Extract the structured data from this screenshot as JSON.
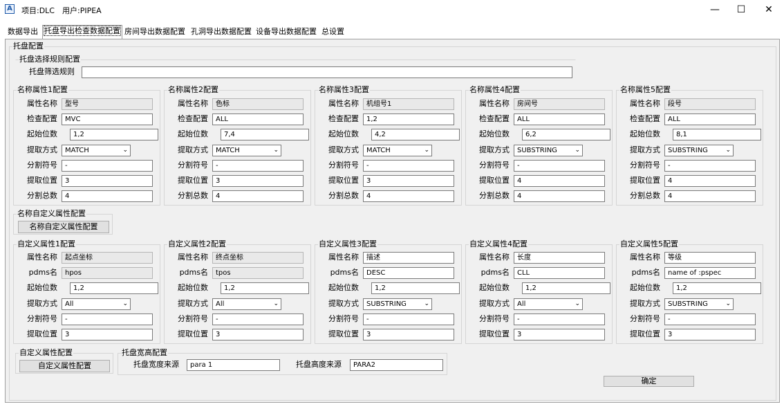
{
  "titlebar": {
    "icon_letter": "A",
    "project": "项目:DLC",
    "user": "用户:PIPEA",
    "minimize": "—",
    "maximize": "☐",
    "close": "✕"
  },
  "tabs": [
    "数据导出",
    "托盘导出检查数据配置",
    "房间导出数据配置",
    "孔洞导出数据配置",
    "设备导出数据配置",
    "总设置"
  ],
  "panel": {
    "title": "托盘配置",
    "rule_group": {
      "title": "托盘选择规则配置",
      "label": "托盘筛选规则",
      "value": ""
    },
    "name_groups": [
      {
        "title": "名称属性1配置",
        "fields": [
          "属性名称",
          "检查配置",
          "起始位数",
          "提取方式",
          "分割符号",
          "提取位置",
          "分割总数"
        ],
        "values": [
          "型号",
          "MVC",
          "1,2",
          "MATCH",
          "-",
          "3",
          "4"
        ]
      },
      {
        "title": "名称属性2配置",
        "fields": [
          "属性名称",
          "检查配置",
          "起始位数",
          "提取方式",
          "分割符号",
          "提取位置",
          "分割总数"
        ],
        "values": [
          "色标",
          "ALL",
          "7,4",
          "MATCH",
          "-",
          "3",
          "4"
        ]
      },
      {
        "title": "名称属性3配置",
        "fields": [
          "属性名称",
          "检查配置",
          "起始位数",
          "提取方式",
          "分割符号",
          "提取位置",
          "分割总数"
        ],
        "values": [
          "机组号1",
          "1,2",
          "4,2",
          "MATCH",
          "-",
          "3",
          "4"
        ]
      },
      {
        "title": "名称属性4配置",
        "fields": [
          "属性名称",
          "检查配置",
          "起始位数",
          "提取方式",
          "分割符号",
          "提取位置",
          "分割总数"
        ],
        "values": [
          "房间号",
          "ALL",
          "6,2",
          "SUBSTRING",
          "-",
          "4",
          "4"
        ]
      },
      {
        "title": "名称属性5配置",
        "fields": [
          "属性名称",
          "检查配置",
          "起始位数",
          "提取方式",
          "分割符号",
          "提取位置",
          "分割总数"
        ],
        "values": [
          "段号",
          "ALL",
          "8,1",
          "SUBSTRING",
          "-",
          "4",
          "4"
        ]
      }
    ],
    "name_custom": {
      "title": "名称自定义属性配置",
      "button": "名称自定义属性配置"
    },
    "custom_groups": [
      {
        "title": "自定义属性1配置",
        "fields": [
          "属性名称",
          "pdms名",
          "起始位数",
          "提取方式",
          "分割符号",
          "提取位置"
        ],
        "values": [
          "起点坐标",
          "hpos",
          "1,2",
          "All",
          "-",
          "3"
        ]
      },
      {
        "title": "自定义属性2配置",
        "fields": [
          "属性名称",
          "pdms名",
          "起始位数",
          "提取方式",
          "分割符号",
          "提取位置"
        ],
        "values": [
          "终点坐标",
          "tpos",
          "1,2",
          "All",
          "-",
          "3"
        ]
      },
      {
        "title": "自定义属性3配置",
        "fields": [
          "属性名称",
          "pdms名",
          "起始位数",
          "提取方式",
          "分割符号",
          "提取位置"
        ],
        "values": [
          "描述",
          "DESC",
          "1,2",
          "SUBSTRING",
          "-",
          "3"
        ]
      },
      {
        "title": "自定义属性4配置",
        "fields": [
          "属性名称",
          "pdms名",
          "起始位数",
          "提取方式",
          "分割符号",
          "提取位置"
        ],
        "values": [
          "长度",
          "CLL",
          "1,2",
          "All",
          "-",
          "3"
        ]
      },
      {
        "title": "自定义属性5配置",
        "fields": [
          "属性名称",
          "pdms名",
          "起始位数",
          "提取方式",
          "分割符号",
          "提取位置"
        ],
        "values": [
          "等级",
          "name of :pspec",
          "1,2",
          "SUBSTRING",
          "-",
          "3"
        ]
      }
    ],
    "custom": {
      "title": "自定义属性配置",
      "button": "自定义属性配置"
    },
    "tray": {
      "title": "托盘宽高配置",
      "width_label": "托盘宽度来源",
      "width_value": "para 1",
      "height_label": "托盘高度来源",
      "height_value": "PARA2"
    },
    "confirm": "确定"
  }
}
